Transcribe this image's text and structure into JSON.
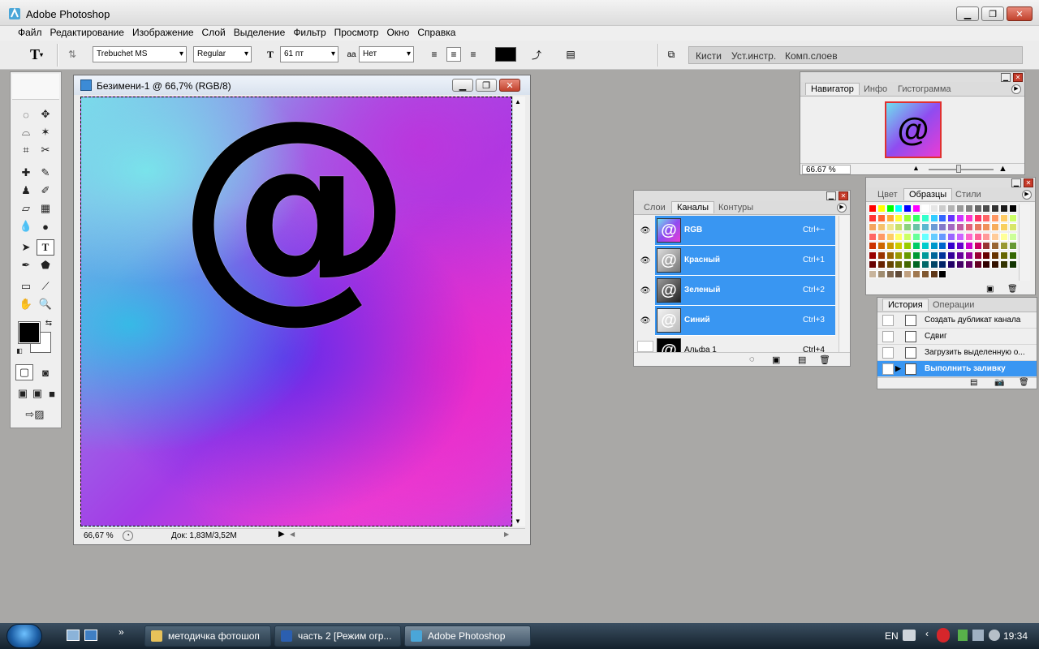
{
  "window": {
    "title": "Adobe Photoshop",
    "minimize": "▁",
    "maximize": "❐",
    "close": "✕"
  },
  "menu": [
    "Файл",
    "Редактирование",
    "Изображение",
    "Слой",
    "Выделение",
    "Фильтр",
    "Просмотр",
    "Окно",
    "Справка"
  ],
  "options": {
    "tool_glyph": "T",
    "font_family": "Trebuchet MS",
    "font_style": "Regular",
    "font_size": "61 пт",
    "aa_label": "aa",
    "anti_alias": "Нет",
    "color": "#000000",
    "well_tabs": [
      "Кисти",
      "Уст.инстр.",
      "Комп.слоев"
    ]
  },
  "document": {
    "title": "Безимени-1 @ 66,7% (RGB/8)",
    "content_glyph": "@",
    "zoom": "66,67 %",
    "doc_info": "Док: 1,83M/3,52M"
  },
  "navigator": {
    "tabs": [
      "Навигатор",
      "Инфо",
      "Гистограмма"
    ],
    "zoom": "66.67 %",
    "thumb_glyph": "@"
  },
  "swatches": {
    "tabs": [
      "Цвет",
      "Образцы",
      "Стили"
    ],
    "colors": [
      [
        "#ff0000",
        "#ffff00",
        "#00ff00",
        "#00ffff",
        "#0000ff",
        "#ff00ff",
        "#ffffff",
        "#e6e6e6",
        "#cccccc",
        "#b3b3b3",
        "#999999",
        "#808080",
        "#666666",
        "#4d4d4d",
        "#333333",
        "#1a1a1a",
        "#000000"
      ],
      [
        "#ff3333",
        "#ff6633",
        "#ffaa33",
        "#ffff33",
        "#99ff33",
        "#33ff66",
        "#33ffcc",
        "#33ccff",
        "#3366ff",
        "#6633ff",
        "#cc33ff",
        "#ff33cc",
        "#ff3366",
        "#ff6666",
        "#ff9966",
        "#ffcc66",
        "#ccff66"
      ],
      [
        "#f4a460",
        "#f5c16c",
        "#f0e68c",
        "#c8e06b",
        "#8cd17d",
        "#6ac3a5",
        "#5bb8d0",
        "#6b9bd6",
        "#8479c9",
        "#a468c2",
        "#c25da3",
        "#e26079",
        "#e8785f",
        "#f0915b",
        "#f6ad5c",
        "#f8d060",
        "#d8e66a"
      ],
      [
        "#ff6666",
        "#ff9966",
        "#ffcc66",
        "#ffff66",
        "#ccff66",
        "#66ff99",
        "#66ffff",
        "#66ccff",
        "#6699ff",
        "#9966ff",
        "#cc66ff",
        "#ff66cc",
        "#ff6699",
        "#ff9999",
        "#ffcc99",
        "#ffff99",
        "#ccff99"
      ],
      [
        "#cc3300",
        "#cc6600",
        "#cc9900",
        "#cccc00",
        "#99cc00",
        "#00cc66",
        "#00cccc",
        "#0099cc",
        "#0066cc",
        "#3300cc",
        "#6600cc",
        "#cc00cc",
        "#cc0066",
        "#993333",
        "#996633",
        "#999933",
        "#669933"
      ],
      [
        "#990000",
        "#993300",
        "#996600",
        "#999900",
        "#669900",
        "#009933",
        "#009999",
        "#006699",
        "#003399",
        "#330099",
        "#660099",
        "#990099",
        "#990033",
        "#660000",
        "#663300",
        "#666600",
        "#336600"
      ],
      [
        "#660000",
        "#662200",
        "#664400",
        "#666600",
        "#446600",
        "#006622",
        "#006666",
        "#004466",
        "#002266",
        "#220066",
        "#440066",
        "#660066",
        "#660022",
        "#330000",
        "#331100",
        "#333300",
        "#113300"
      ],
      [
        "#c8b49c",
        "#a08c70",
        "#806850",
        "#604a38",
        "#c0a080",
        "#a07850",
        "#805830",
        "#603818",
        "#000000"
      ]
    ]
  },
  "channels": {
    "tabs": [
      "Слои",
      "Каналы",
      "Контуры"
    ],
    "rows": [
      {
        "name": "RGB",
        "shortcut": "Ctrl+~"
      },
      {
        "name": "Красный",
        "shortcut": "Ctrl+1"
      },
      {
        "name": "Зеленый",
        "shortcut": "Ctrl+2"
      },
      {
        "name": "Синий",
        "shortcut": "Ctrl+3"
      },
      {
        "name": "Альфа 1",
        "shortcut": "Ctrl+4"
      }
    ]
  },
  "history": {
    "tabs": [
      "История",
      "Операции"
    ],
    "items": [
      "Создать дубликат канала",
      "Сдвиг",
      "Загрузить выделенную о...",
      "Выполнить заливку"
    ]
  },
  "taskbar": {
    "items": [
      "методичка фотошоп",
      "часть 2 [Режим огр...",
      "Adobe Photoshop"
    ],
    "lang": "EN",
    "clock": "19:34",
    "expand": "»"
  }
}
